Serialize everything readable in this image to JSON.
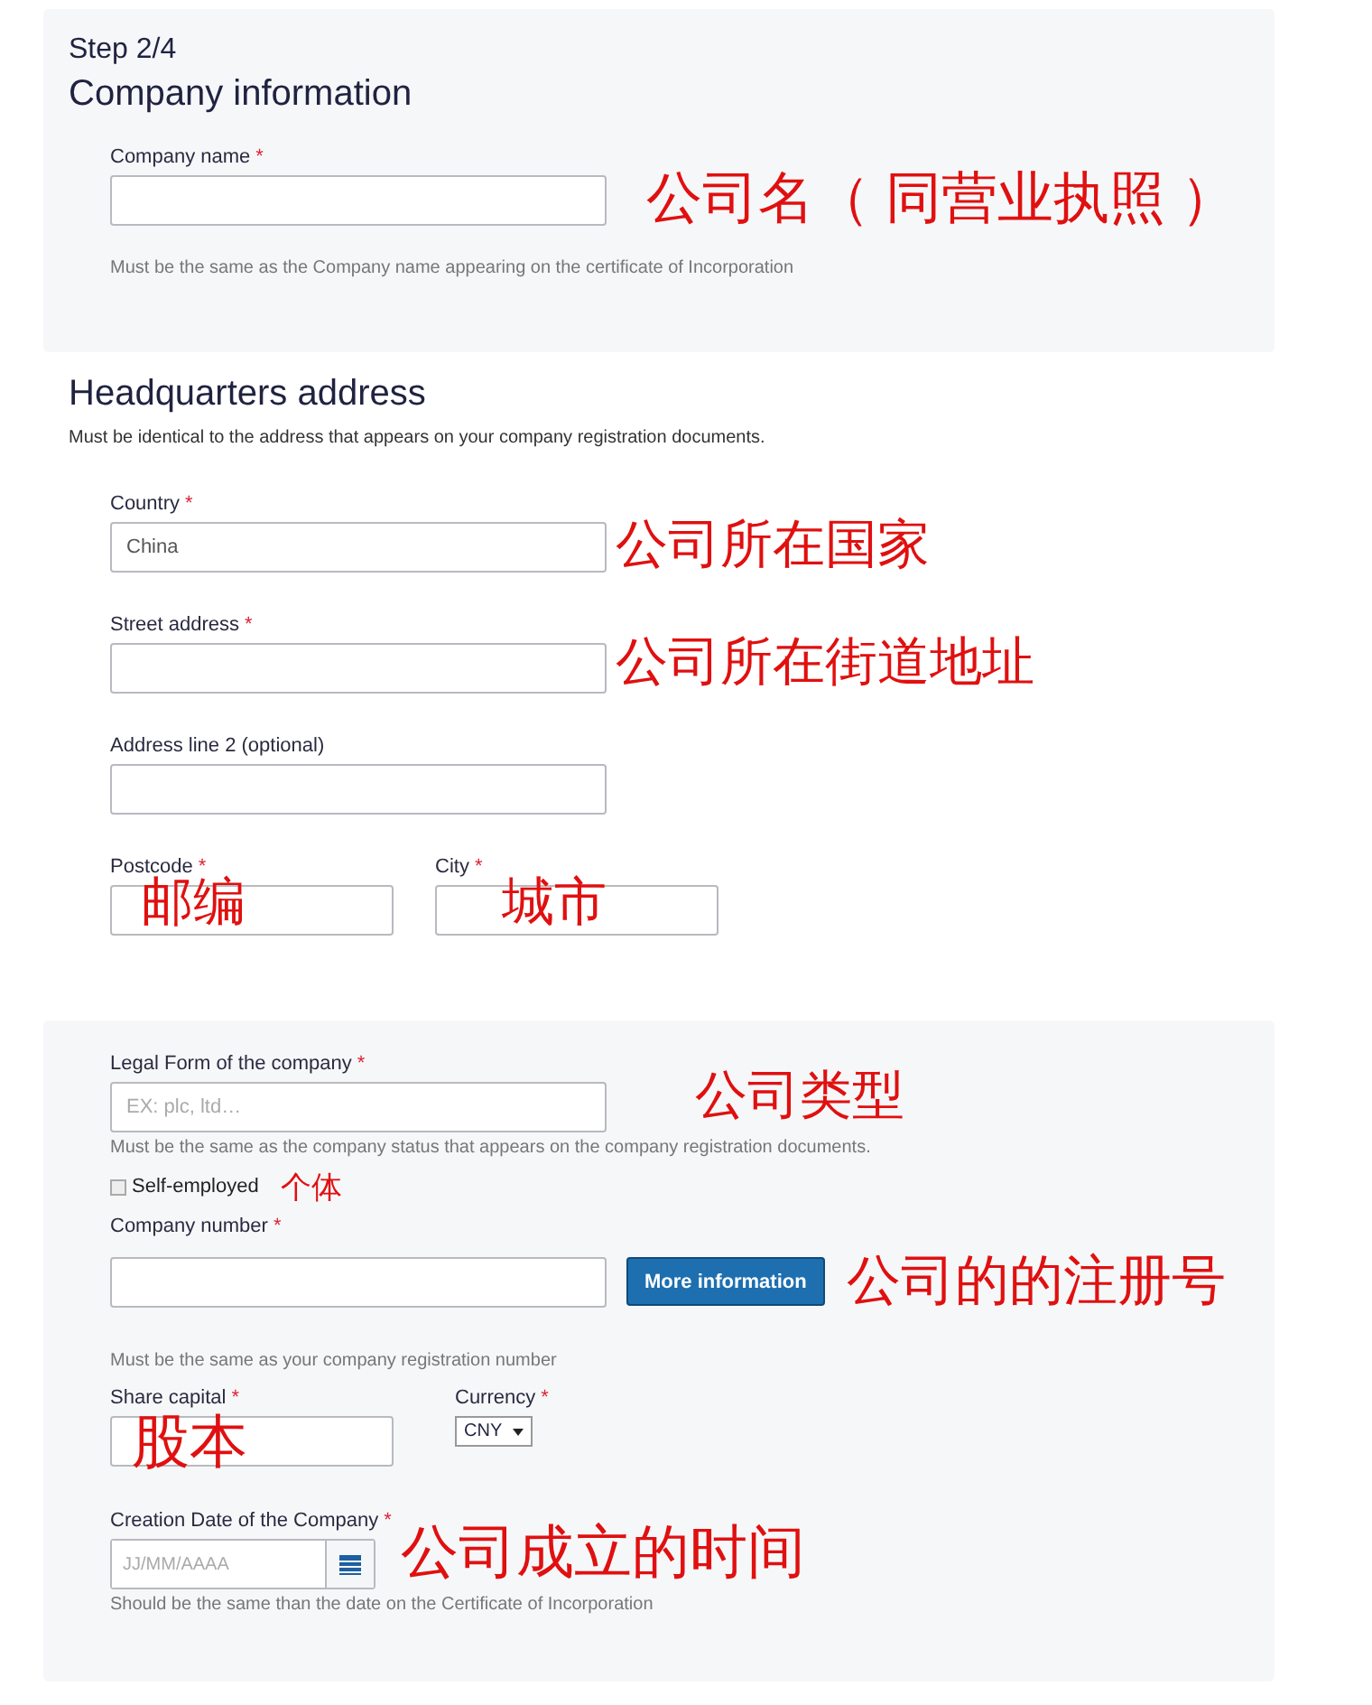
{
  "step": "Step 2/4",
  "company_info": {
    "title": "Company information",
    "company_name": {
      "label": "Company name",
      "required": "*",
      "help": "Must be the same as the Company name appearing on the certificate of Incorporation",
      "note": "公司名（ 同营业执照 ）"
    }
  },
  "headquarters": {
    "title": "Headquarters address",
    "description": "Must be identical to the address that appears on your company registration documents.",
    "country": {
      "label": "Country",
      "required": "*",
      "value": "China",
      "note": "公司所在国家"
    },
    "street": {
      "label": "Street address",
      "required": "*",
      "note": "公司所在街道地址"
    },
    "address2": {
      "label": "Address line 2 (optional)"
    },
    "postcode": {
      "label": "Postcode",
      "required": "*",
      "note": "邮编"
    },
    "city": {
      "label": "City",
      "required": "*",
      "note": "城市"
    }
  },
  "legal": {
    "legal_form": {
      "label": "Legal Form of the company",
      "required": "*",
      "placeholder": "EX: plc, ltd…",
      "help": "Must be the same as the company status that appears on the company registration documents.",
      "note": "公司类型"
    },
    "self_employed": {
      "label": "Self-employed",
      "checked": false,
      "note": "个体"
    },
    "company_number": {
      "label": "Company number",
      "required": "*",
      "button": "More information",
      "help": "Must be the same as your company registration number",
      "note": "公司的的注册号"
    },
    "share_capital": {
      "label": "Share capital",
      "required": "*",
      "note": "股本"
    },
    "currency": {
      "label": "Currency",
      "required": "*",
      "value": "CNY"
    },
    "creation_date": {
      "label": "Creation Date of the Company",
      "required": "*",
      "placeholder": "JJ/MM/AAAA",
      "help": "Should be the same than the date on the Certificate of Incorporation",
      "note": "公司成立的时间"
    }
  }
}
